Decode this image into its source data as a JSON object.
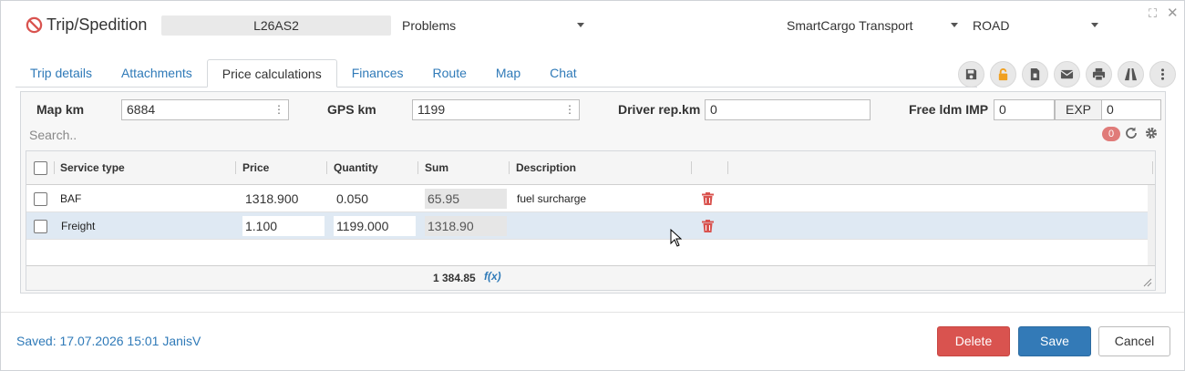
{
  "header": {
    "title": "Trip/Spedition",
    "code": "L26AS2",
    "status_select": "Problems",
    "company_select": "SmartCargo Transport",
    "mode_select": "ROAD"
  },
  "tabs": [
    {
      "label": "Trip details"
    },
    {
      "label": "Attachments"
    },
    {
      "label": "Price calculations",
      "active": true
    },
    {
      "label": "Finances"
    },
    {
      "label": "Route"
    },
    {
      "label": "Map"
    },
    {
      "label": "Chat"
    }
  ],
  "toolbar": [
    "save-icon",
    "unlock-icon",
    "document-icon",
    "mail-icon",
    "print-icon",
    "road-icon",
    "more-icon"
  ],
  "km": {
    "map_km_label": "Map km",
    "map_km_value": "6884",
    "gps_km_label": "GPS km",
    "gps_km_value": "1199",
    "driver_km_label": "Driver rep.km",
    "driver_km_value": "0",
    "free_ldm_label": "Free ldm IMP",
    "free_ldm_imp": "0",
    "exp_label": "EXP",
    "free_ldm_exp": "0"
  },
  "search": {
    "placeholder": "Search..",
    "filter_count": "0"
  },
  "grid": {
    "columns": [
      "Service type",
      "Price",
      "Quantity",
      "Sum",
      "Description"
    ],
    "rows": [
      {
        "service_type": "BAF",
        "price": "1318.900",
        "quantity": "0.050",
        "sum": "65.95",
        "description": "fuel surcharge"
      },
      {
        "service_type": "Freight",
        "price": "1.100",
        "quantity": "1199.000",
        "sum": "1318.90",
        "description": ""
      }
    ],
    "total": "1 384.85",
    "fx_label": "f(x)"
  },
  "footer": {
    "saved_text": "Saved: 17.07.2026 15:01 JanisV",
    "delete_label": "Delete",
    "save_label": "Save",
    "cancel_label": "Cancel"
  },
  "colors": {
    "accent": "#337ab7",
    "danger": "#d9534f",
    "link": "#2f7ab8",
    "badge": "#e07b79"
  }
}
